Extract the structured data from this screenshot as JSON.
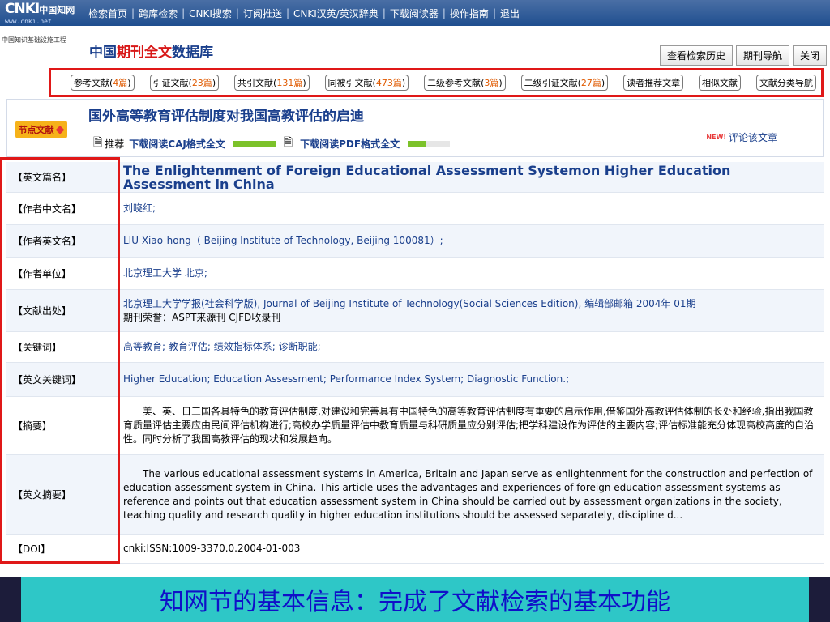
{
  "topbar": {
    "logo_main": "CNKI",
    "logo_cn": "中国知网",
    "logo_url": "www.cnki.net",
    "nav": [
      "检索首页",
      "跨库检索",
      "CNKI搜索",
      "订阅推送",
      "CNKI汉英/英汉辞典",
      "下载阅读器",
      "操作指南",
      "退出"
    ]
  },
  "header": {
    "org": "中国知识基础设施工程",
    "db_title_a": "中国",
    "db_title_b": "期刊",
    "db_title_c": "全文",
    "db_title_d": "数据库",
    "buttons": [
      "查看检索历史",
      "期刊导航",
      "关闭"
    ]
  },
  "reflinks": [
    {
      "label": "参考文献",
      "count": "4篇"
    },
    {
      "label": "引证文献",
      "count": "23篇"
    },
    {
      "label": "共引文献",
      "count": "131篇"
    },
    {
      "label": "同被引文献",
      "count": "473篇"
    },
    {
      "label": "二级参考文献",
      "count": "3篇"
    },
    {
      "label": "二级引证文献",
      "count": "27篇"
    },
    {
      "label": "读者推荐文章",
      "count": ""
    },
    {
      "label": "相似文献",
      "count": ""
    },
    {
      "label": "文献分类导航",
      "count": ""
    }
  ],
  "article": {
    "hot_label": "节点文献",
    "title": "国外高等教育评估制度对我国高教评估的启迪",
    "recommend": "推荐",
    "caj_link": "下载阅读CAJ格式全文",
    "pdf_link": "下载阅读PDF格式全文",
    "caj_meter": 1.0,
    "pdf_meter": 0.45,
    "new_tag": "NEW!",
    "comment": "评论该文章"
  },
  "info": {
    "en_title_label": "【英文篇名】",
    "en_title": "The Enlightenment of Foreign Educational Assessment Systemon Higher Education Assessment in China",
    "author_cn_label": "【作者中文名】",
    "author_cn": "刘晓红;",
    "author_en_label": "【作者英文名】",
    "author_en": "LIU Xiao-hong（ Beijing Institute of Technology, Beijing 100081）;",
    "unit_label": "【作者单位】",
    "unit": "北京理工大学  北京;",
    "source_label": "【文献出处】",
    "source": "北京理工大学学报(社会科学版), Journal of Beijing Institute of Technology(Social Sciences Edition), 编辑部邮箱  2004年  01期",
    "source_sub": "期刊荣誉：ASPT来源刊  CJFD收录刊",
    "keywords_label": "【关键词】",
    "keywords": "高等教育; 教育评估; 绩效指标体系; 诊断职能;",
    "en_keywords_label": "【英文关键词】",
    "en_keywords": "Higher Education; Education Assessment; Performance Index System; Diagnostic Function.;",
    "abstract_label": "【摘要】",
    "abstract": "美、英、日三国各具特色的教育评估制度,对建设和完善具有中国特色的高等教育评估制度有重要的启示作用,借鉴国外高教评估体制的长处和经验,指出我国教育质量评估主要应由民间评估机构进行;高校办学质量评估中教育质量与科研质量应分别评估;把学科建设作为评估的主要内容;评估标准能充分体现高校高度的自治性。同时分析了我国高教评估的现状和发展趋向。",
    "en_abstract_label": "【英文摘要】",
    "en_abstract": "The various educational assessment systems in America, Britain and Japan serve as enlightenment for the construction and perfection of education assessment system in China. This article uses the advantages and experiences of foreign education assessment systems as reference and points out that education assessment system in China should be carried out by assessment organizations in the society, teaching quality and research quality in higher education institutions should be assessed separately, discipline d...",
    "doi_label": "【DOI】",
    "doi": "cnki:ISSN:1009-3370.0.2004-01-003"
  },
  "caption": "知网节的基本信息：完成了文献检索的基本功能",
  "colors": {
    "accent": "#1a3f8c",
    "highlight_box": "#e01818",
    "caption_bg": "#2ec7c7",
    "caption_text": "#1010c8"
  }
}
